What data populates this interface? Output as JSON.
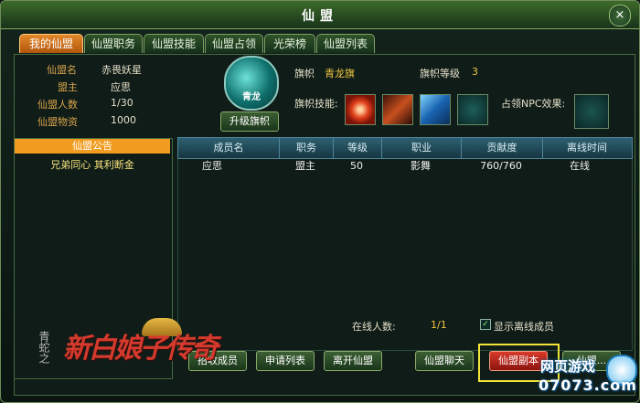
{
  "window": {
    "title": "仙盟",
    "close_symbol": "×"
  },
  "tabs": [
    {
      "label": "我的仙盟",
      "active": true
    },
    {
      "label": "仙盟职务"
    },
    {
      "label": "仙盟技能"
    },
    {
      "label": "仙盟占领"
    },
    {
      "label": "光荣榜"
    },
    {
      "label": "仙盟列表"
    }
  ],
  "guild_info": {
    "name_label": "仙盟名",
    "name_value": "赤畏妖星",
    "leader_label": "盟主",
    "leader_value": "应思",
    "members_label": "仙盟人数",
    "members_value": "1/30",
    "resources_label": "仙盟物资",
    "resources_value": "1000"
  },
  "flag": {
    "emblem_text": "青龙",
    "upgrade_button": "升级旗帜",
    "flag_label": "旗帜",
    "flag_value": "青龙旗",
    "level_label": "旗帜等级",
    "level_value": "3",
    "skills_label": "旗帜技能:",
    "npc_label": "占领NPC效果:"
  },
  "notice": {
    "header": "仙盟公告",
    "text": "兄弟同心 其利断金"
  },
  "member_table": {
    "headers": [
      "成员名",
      "职务",
      "等级",
      "职业",
      "贡献度",
      "离线时间"
    ],
    "rows": [
      [
        "应思",
        "盟主",
        "50",
        "影舞",
        "760/760",
        "在线"
      ]
    ]
  },
  "footer": {
    "online_label": "在线人数:",
    "online_value": "1/1",
    "show_offline_label": "显示离线成员",
    "buttons": {
      "recruit": "招收成员",
      "apply_list": "申请列表",
      "leave": "离开仙盟",
      "chat": "仙盟聊天",
      "dungeon": "仙盟副本",
      "other": "仙盟..."
    }
  },
  "branding": {
    "logo_main": "新白娘子传奇",
    "logo_side": "青蛇之",
    "watermark_top": "网页游戏",
    "watermark_bottom": "07073.com"
  },
  "colors": {
    "active_tab": "#e2872a",
    "label_gold": "#d9a34a",
    "dungeon_button": "#d83a2a",
    "highlight_box": "#f3e43a",
    "notice_header": "#f19c20"
  }
}
